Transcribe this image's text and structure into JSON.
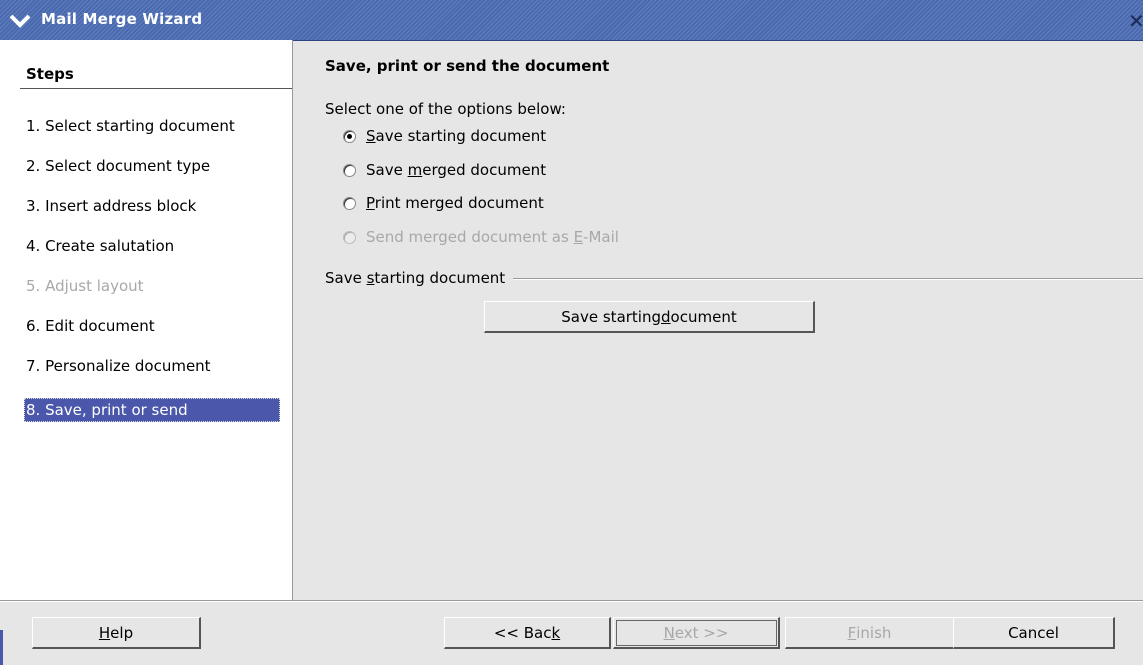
{
  "window": {
    "title": "Mail Merge Wizard",
    "menu_icon": "chevron-down-icon",
    "close_icon": "close-icon"
  },
  "sidebar": {
    "title": "Steps",
    "steps": [
      {
        "label": "1. Select starting document",
        "state": "normal"
      },
      {
        "label": "2. Select document type",
        "state": "normal"
      },
      {
        "label": "3. Insert address block",
        "state": "normal"
      },
      {
        "label": "4. Create salutation",
        "state": "normal"
      },
      {
        "label": "5. Adjust layout",
        "state": "disabled"
      },
      {
        "label": "6. Edit document",
        "state": "normal"
      },
      {
        "label": "7. Personalize document",
        "state": "normal"
      },
      {
        "label": "8. Save, print or send",
        "state": "active"
      }
    ]
  },
  "main": {
    "heading": "Save, print or send the document",
    "prompt": "Select one of the options below:",
    "options": [
      {
        "label": "Save starting document",
        "mnemonic": "S",
        "selected": true,
        "enabled": true
      },
      {
        "label": "Save merged document",
        "mnemonic": "m",
        "selected": false,
        "enabled": true
      },
      {
        "label": "Print merged document",
        "mnemonic": "P",
        "selected": false,
        "enabled": true
      },
      {
        "label": "Send merged document as E-Mail",
        "mnemonic": "E",
        "selected": false,
        "enabled": false
      }
    ],
    "group_label": "Save starting document",
    "group_button": "Save starting document"
  },
  "footer": {
    "help": "Help",
    "back": "<< Back",
    "next": ">>",
    "next_word": "Next",
    "finish": "Finish",
    "cancel": "Cancel"
  },
  "colors": {
    "titlebar": "#4a69ad",
    "selection": "#4b57aa",
    "disabled_text": "#a8a8a8",
    "panel": "#e6e6e6"
  }
}
